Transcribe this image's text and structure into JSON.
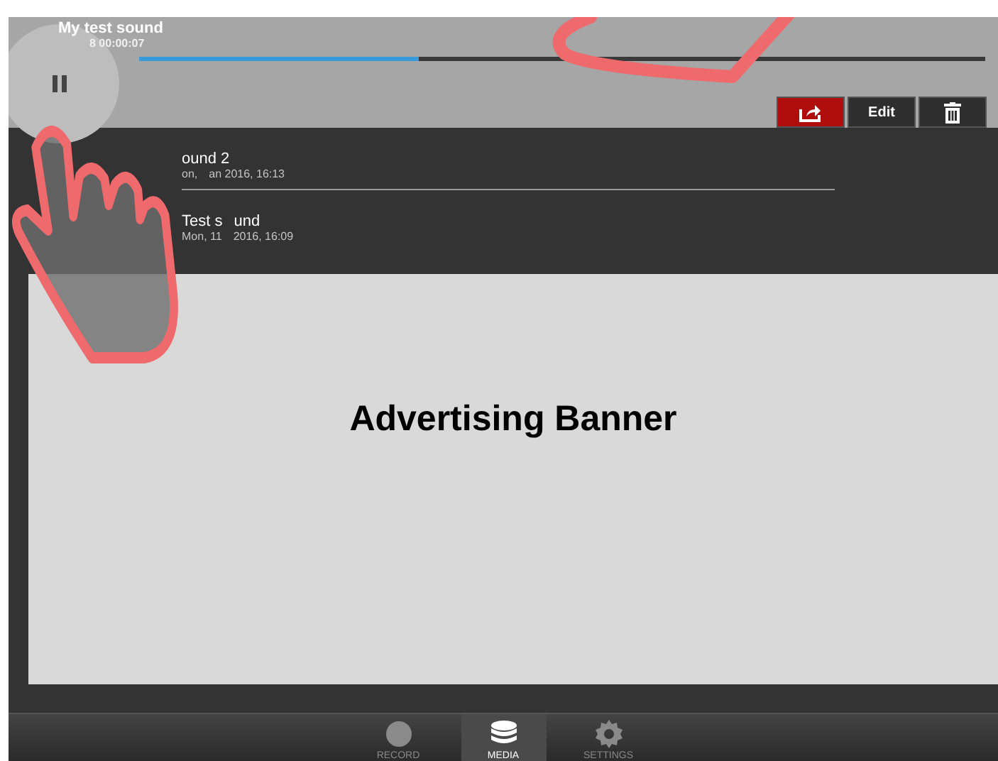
{
  "player": {
    "title": "My test sound",
    "time": "8 00:00:07",
    "progress": {
      "level": 0.33
    },
    "playing": true,
    "actions": [
      {
        "kind": "share",
        "selected": true
      },
      {
        "kind": "edit",
        "label": "Edit",
        "selected": false
      },
      {
        "kind": "delete",
        "selected": false
      }
    ]
  },
  "recordings": [
    {
      "title_parts": [
        "ound 2"
      ],
      "subtitle_parts": [
        "on,",
        "an 2016, 16:13"
      ]
    },
    {
      "title_parts": [
        "Test s",
        "und"
      ],
      "subtitle_parts": [
        "Mon, 11",
        "2016, 16:09"
      ]
    }
  ],
  "banner": {
    "text": "Advertising Banner"
  },
  "tabs": [
    {
      "kind": "record",
      "label": "RECORD",
      "selected": false
    },
    {
      "kind": "media",
      "label": "MEDIA",
      "selected": true
    },
    {
      "kind": "settings",
      "label": "SETTINGS",
      "selected": false
    }
  ]
}
